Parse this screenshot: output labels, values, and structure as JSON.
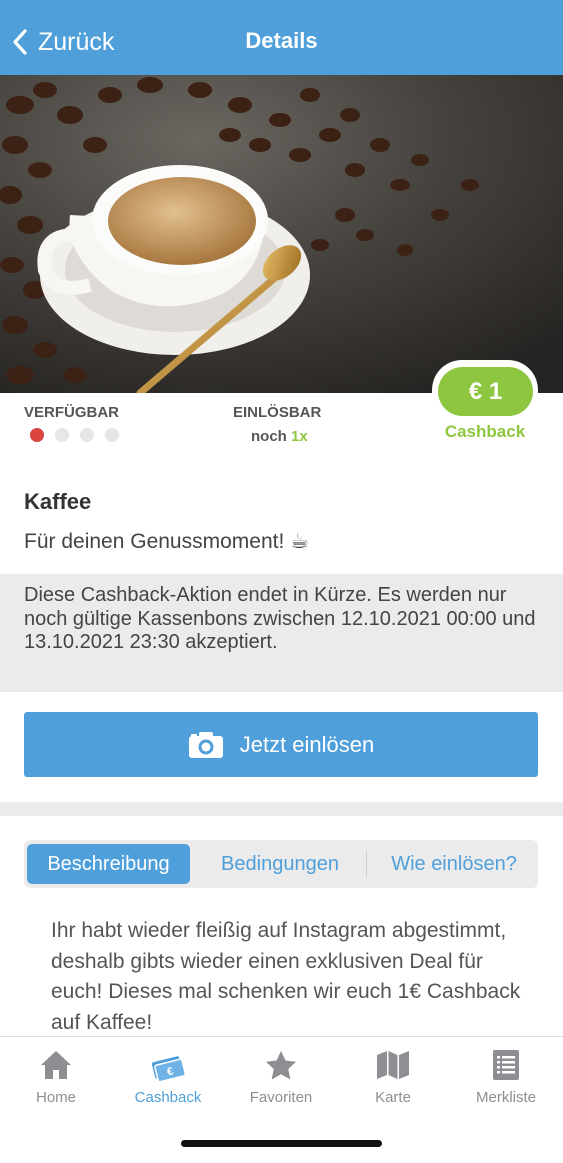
{
  "header": {
    "back_label": "Zurück",
    "title": "Details"
  },
  "cashback": {
    "value": "€ 1",
    "label": "Cashback"
  },
  "availability": {
    "label": "VERFÜGBAR",
    "dots_total": 4,
    "dots_active": 1
  },
  "redeemable": {
    "label": "EINLÖSBAR",
    "prefix": "noch",
    "count": "1x"
  },
  "deal": {
    "title": "Kaffee",
    "subtitle": "Für deinen Genussmoment! ☕"
  },
  "notice": "Diese Cashback-Aktion endet in Kürze. Es werden nur noch gültige Kassenbons zwischen 12.10.2021 00:00 und 13.10.2021 23:30 akzeptiert.",
  "redeem_button": {
    "label": "Jetzt einlösen",
    "icon": "camera-icon"
  },
  "tabs": [
    {
      "label": "Beschreibung",
      "active": true
    },
    {
      "label": "Bedingungen",
      "active": false
    },
    {
      "label": "Wie einlösen?",
      "active": false
    }
  ],
  "description": "Ihr habt wieder fleißig auf Instagram abgestimmt, deshalb gibts wieder einen exklusiven Deal für euch! Dieses mal schenken wir euch 1€ Cashback auf Kaffee!",
  "tabbar": [
    {
      "label": "Home",
      "icon": "home-icon",
      "active": false
    },
    {
      "label": "Cashback",
      "icon": "cashback-icon",
      "active": true
    },
    {
      "label": "Favoriten",
      "icon": "star-icon",
      "active": false
    },
    {
      "label": "Karte",
      "icon": "map-icon",
      "active": false
    },
    {
      "label": "Merkliste",
      "icon": "list-icon",
      "active": false
    }
  ],
  "colors": {
    "primary": "#4f9fdb",
    "accent_green": "#8ec63f",
    "dot_active": "#d9443c",
    "muted_bg": "#ebebec"
  }
}
